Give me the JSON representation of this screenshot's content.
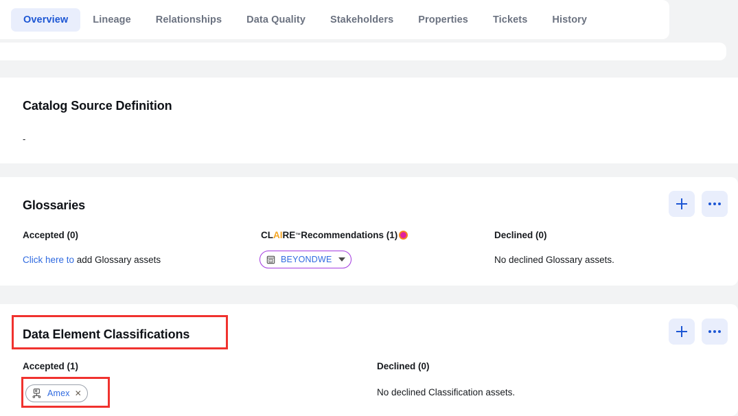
{
  "tabs": [
    {
      "label": "Overview",
      "active": true
    },
    {
      "label": "Lineage",
      "active": false
    },
    {
      "label": "Relationships",
      "active": false
    },
    {
      "label": "Data Quality",
      "active": false
    },
    {
      "label": "Stakeholders",
      "active": false
    },
    {
      "label": "Properties",
      "active": false
    },
    {
      "label": "Tickets",
      "active": false
    },
    {
      "label": "History",
      "active": false
    }
  ],
  "catalog_source_definition": {
    "title": "Catalog Source Definition",
    "value": "-"
  },
  "glossaries": {
    "title": "Glossaries",
    "accepted_label": "Accepted (0)",
    "accepted_empty_link": "Click here to",
    "accepted_empty_rest": " add Glossary assets",
    "claire_prefix": "CL",
    "claire_ai": "AI",
    "claire_suffix": "RE",
    "claire_tm": "™",
    "claire_recommendations": " Recommendations (1)",
    "recommendation_chip": {
      "label": "BEYONDWE",
      "icon": "glossary-icon"
    },
    "declined_label": "Declined (0)",
    "declined_empty": "No declined Glossary assets.",
    "add_icon": "plus-icon",
    "more_icon": "more-horizontal-icon"
  },
  "data_element_classifications": {
    "title": "Data Element Classifications",
    "accepted_label": "Accepted (1)",
    "accepted_chips": [
      {
        "label": "Amex",
        "icon": "classification-icon",
        "remove_icon": "close-icon"
      }
    ],
    "declined_label": "Declined (0)",
    "declined_empty": "No declined Classification assets.",
    "add_icon": "plus-icon",
    "more_icon": "more-horizontal-icon"
  },
  "annotations": [
    {
      "name": "highlight-classifications-title"
    },
    {
      "name": "highlight-amex-chip"
    }
  ],
  "colors": {
    "accent_blue": "#1c56d4",
    "link_blue": "#2f6ae0",
    "tab_active_bg": "#e9eefc",
    "page_bg": "#f2f3f4",
    "claire_orange": "#f5a623",
    "claire_magenta": "#e0219e",
    "chip_purple": "#a33ae0",
    "annotation_red": "#f0322e"
  }
}
